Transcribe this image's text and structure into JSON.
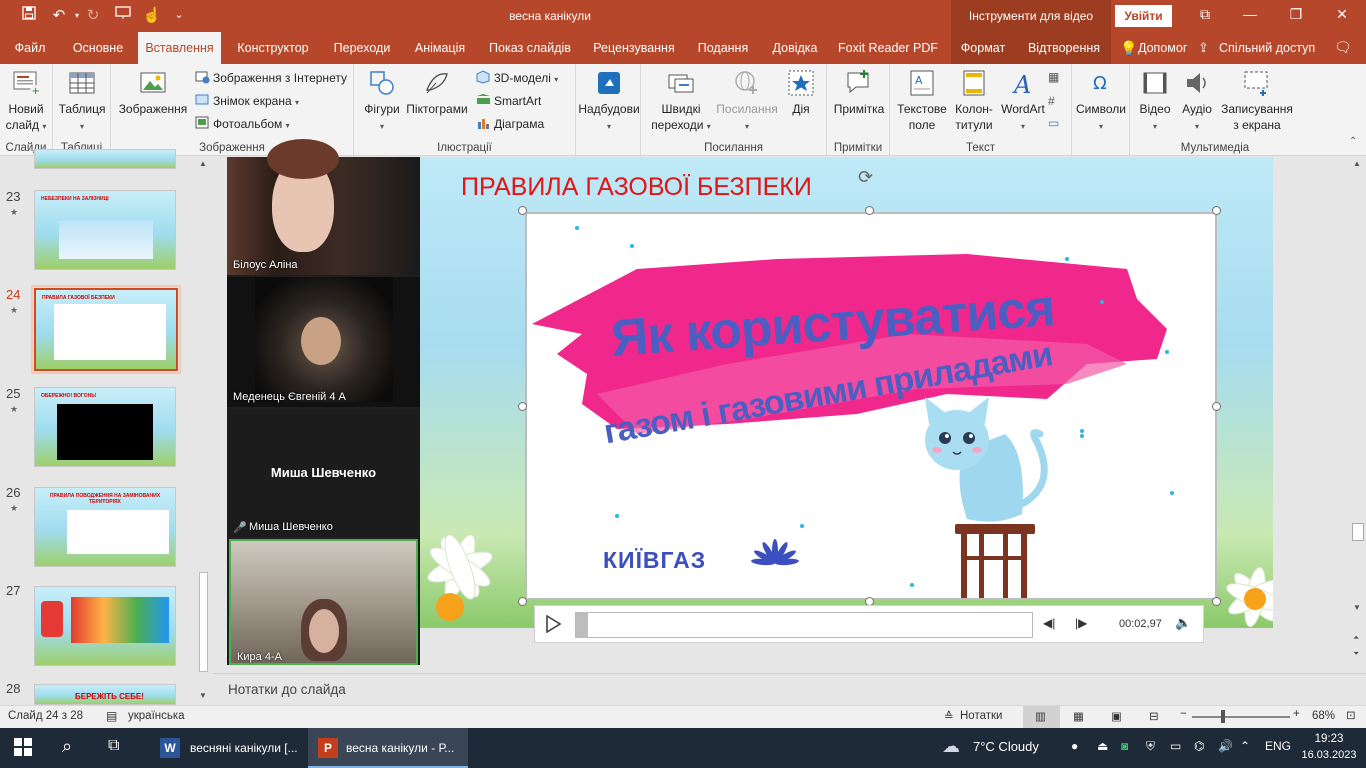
{
  "titlebar": {
    "title": "весна канікули",
    "context_group": "Інструменти для відео",
    "signin": "Увійти"
  },
  "tabs": [
    "Файл",
    "Основне",
    "Вставлення",
    "Конструктор",
    "Переходи",
    "Анімація",
    "Показ слайдів",
    "Рецензування",
    "Подання",
    "Довідка",
    "Foxit Reader PDF"
  ],
  "context_tabs": [
    "Формат",
    "Відтворення"
  ],
  "tell_me": "Допомог",
  "share": "Спільний доступ",
  "ribbon": {
    "new_slide": [
      "Новий",
      "слайд"
    ],
    "groups": {
      "slides": "Слайди",
      "tables": "Таблиці",
      "images": "Зображення",
      "illustrations": "Ілюстрації",
      "links": "Посилання",
      "comments": "Примітки",
      "text": "Текст",
      "media": "Мультимедіа"
    },
    "table": "Таблиця",
    "images": "Зображення",
    "online_images": "Зображення з Інтернету",
    "screenshot": "Знімок екрана",
    "photo_album": "Фотоальбом",
    "shapes": "Фігури",
    "icons": "Піктограми",
    "models3d": "3D-моделі",
    "smartart": "SmartArt",
    "chart": "Діаграма",
    "addins": "Надбудови",
    "quick_links": [
      "Швидкі",
      "переходи"
    ],
    "link": "Посилання",
    "action": "Дія",
    "comment": "Примітка",
    "textbox": [
      "Текстове",
      "поле"
    ],
    "header_footer": [
      "Колон-",
      "титули"
    ],
    "wordart": "WordArt",
    "symbols": "Символи",
    "video": "Відео",
    "audio": "Аудіо",
    "screen_rec": [
      "Записування",
      "з екрана"
    ]
  },
  "thumbs": [
    {
      "num": "23",
      "title": "НЕБЕЗПЕКИ НА ЗАЛІЗНИЦІ"
    },
    {
      "num": "24",
      "title": "ПРАВИЛА ГАЗОВОЇ БЕЗПЕКИ"
    },
    {
      "num": "25",
      "title": "ОБЕРЕЖНО! ВОГОНЬ!"
    },
    {
      "num": "26",
      "title": "ПРАВИЛА ПОВОДЖЕННЯ НА ЗАМІНОВАНИХ ТЕРИТОРІЯХ"
    },
    {
      "num": "27",
      "title": ""
    },
    {
      "num": "28",
      "title": "БЕРЕЖІТЬ СЕБЕ!"
    }
  ],
  "participants": [
    "Білоус Аліна",
    "Меденець Євгеній 4 А",
    "Миша Шевченко",
    "Миша Шевченко",
    "Кира 4-А"
  ],
  "slide": {
    "title": "ПРАВИЛА ГАЗОВОЇ БЕЗПЕКИ",
    "video_line1": "Як користуватися",
    "video_line2": "газом і газовими приладами",
    "brand": "КИЇВГАЗ"
  },
  "player": {
    "time": "00:02,97"
  },
  "notes": "Нотатки до слайда",
  "status": {
    "slide": "Слайд 24 з 28",
    "lang": "українська",
    "notes_btn": "Нотатки",
    "zoom": "68%"
  },
  "taskbar": {
    "app1": "весняні канікули [...",
    "app2": "весна канікули - Р...",
    "weather": "7°C  Cloudy",
    "lang": "ENG",
    "time": "19:23",
    "date": "16.03.2023"
  },
  "colors": {
    "accent": "#b7472a",
    "title_red": "#e01515",
    "brush_pink": "#f0288c",
    "text_blue": "#4a5fc1"
  }
}
